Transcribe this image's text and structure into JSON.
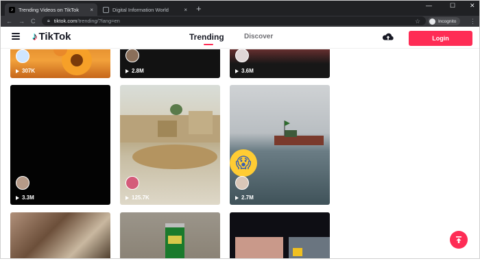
{
  "browser": {
    "tabs": [
      {
        "title": "Trending Videos on TikTok",
        "close": "×"
      },
      {
        "title": "Digital Information World",
        "close": "×"
      }
    ],
    "new_tab": "+",
    "window_controls": {
      "minimize": "—",
      "maximize": "☐",
      "close": "✕"
    },
    "nav": {
      "back": "←",
      "forward": "→",
      "reload": "C"
    },
    "url_host": "tiktok.com",
    "url_path": "/trending/?lang=en",
    "incognito_label": "Incognito"
  },
  "header": {
    "logo_text": "TikTok",
    "nav": [
      {
        "label": "Trending",
        "active": true
      },
      {
        "label": "Discover",
        "active": false
      }
    ],
    "login_label": "Login"
  },
  "feed": {
    "videos": [
      {
        "views": "307K"
      },
      {
        "views": "2.8M"
      },
      {
        "views": "3.6M"
      },
      {
        "views": "3.3M"
      },
      {
        "views": "125.7K"
      },
      {
        "views": "2.7M"
      },
      {
        "views": ""
      },
      {
        "views": ""
      },
      {
        "views": ""
      }
    ]
  },
  "colors": {
    "brand": "#fe2c55",
    "browser_dark": "#202124",
    "text_primary": "#161823"
  },
  "icons": [
    "tiktok-logo-icon",
    "menu-icon",
    "upload-cloud-icon",
    "play-icon",
    "scroll-top-arrow-icon",
    "lock-icon",
    "star-icon",
    "incognito-icon"
  ]
}
